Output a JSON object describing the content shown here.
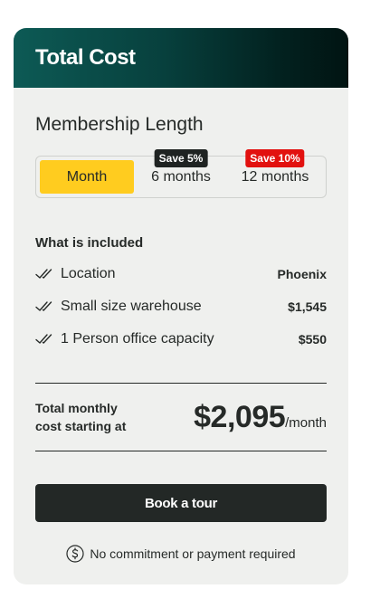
{
  "header": {
    "title": "Total Cost"
  },
  "membership": {
    "title": "Membership Length",
    "options": [
      {
        "label": "Month",
        "badge": "",
        "selected": true
      },
      {
        "label": "6 months",
        "badge": "Save 5%",
        "selected": false
      },
      {
        "label": "12 months",
        "badge": "Save 10%",
        "selected": false
      }
    ]
  },
  "included": {
    "title": "What is included",
    "items": [
      {
        "icon": "double-check-icon",
        "label": "Location",
        "value": "Phoenix"
      },
      {
        "icon": "double-check-icon",
        "label": "Small size warehouse",
        "value": "$1,545"
      },
      {
        "icon": "double-check-icon",
        "label": "1 Person office capacity",
        "value": "$550"
      }
    ]
  },
  "total": {
    "label": "Total monthly cost starting at",
    "price": "$2,095",
    "per": "/month"
  },
  "cta": {
    "label": "Book a tour"
  },
  "note": {
    "icon": "dollar-circle-icon",
    "text": "No commitment or payment required"
  },
  "colors": {
    "accent_yellow": "#ffcc1f",
    "badge_dark": "#1f2322",
    "badge_red": "#e2110f",
    "card_bg": "#eff0ee",
    "button_bg": "#232826"
  }
}
